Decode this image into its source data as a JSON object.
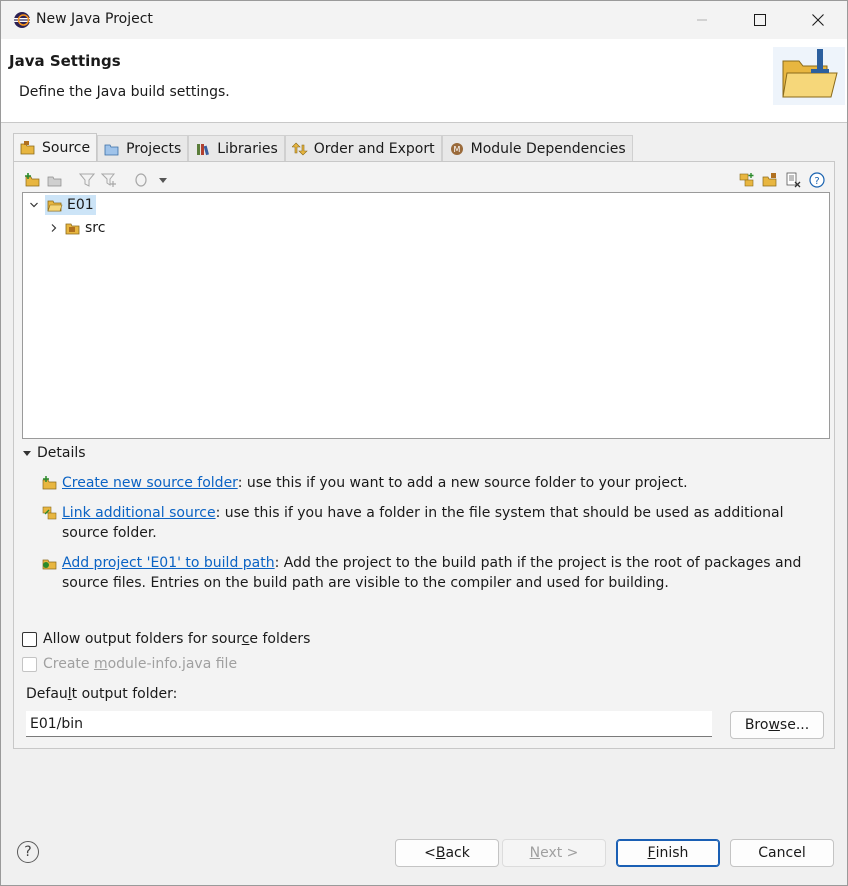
{
  "window": {
    "title": "New Java Project",
    "app_icon": "eclipse-icon",
    "controls": [
      "minimize-icon",
      "maximize-icon",
      "close-icon"
    ]
  },
  "banner": {
    "title": "Java Settings",
    "description": "Define the Java build settings.",
    "icon": "folder-wizard-icon"
  },
  "tabs": [
    {
      "label": "Source",
      "icon": "source-folder-icon",
      "active": true
    },
    {
      "label": "Projects",
      "icon": "projects-icon",
      "active": false
    },
    {
      "label": "Libraries",
      "icon": "libraries-icon",
      "active": false
    },
    {
      "label": "Order and Export",
      "icon": "order-export-icon",
      "active": false
    },
    {
      "label": "Module Dependencies",
      "icon": "module-icon",
      "active": false
    }
  ],
  "tree": {
    "root": {
      "label": "E01",
      "expanded": true,
      "selected": true
    },
    "children": [
      {
        "label": "src",
        "expanded": false
      }
    ]
  },
  "details": {
    "heading": "Details",
    "items": [
      {
        "link": "Create new source folder",
        "text": ": use this if you want to add a new source folder to your project."
      },
      {
        "link": "Link additional source",
        "text": ": use this if you have a folder in the file system that should be used as additional source folder."
      },
      {
        "link": "Add project 'E01' to build path",
        "text": ": Add the project to the build path if the project is the root of packages and source files. Entries on the build path are visible to the compiler and used for building."
      }
    ]
  },
  "options": {
    "allow_output_folders": {
      "label": "Allow output folders for source folders",
      "checked": false
    },
    "create_module_info": {
      "label": "Create module-info.java file",
      "checked": false,
      "enabled": false
    }
  },
  "output": {
    "label": "Default output folder:",
    "value": "E01/bin",
    "browse_label": "Browse..."
  },
  "footer": {
    "back": "< Back",
    "next": "Next >",
    "finish": "Finish",
    "cancel": "Cancel"
  },
  "colors": {
    "link": "#0b63c4",
    "selection": "#cce4f7",
    "default_button_border": "#1a5fb4"
  }
}
